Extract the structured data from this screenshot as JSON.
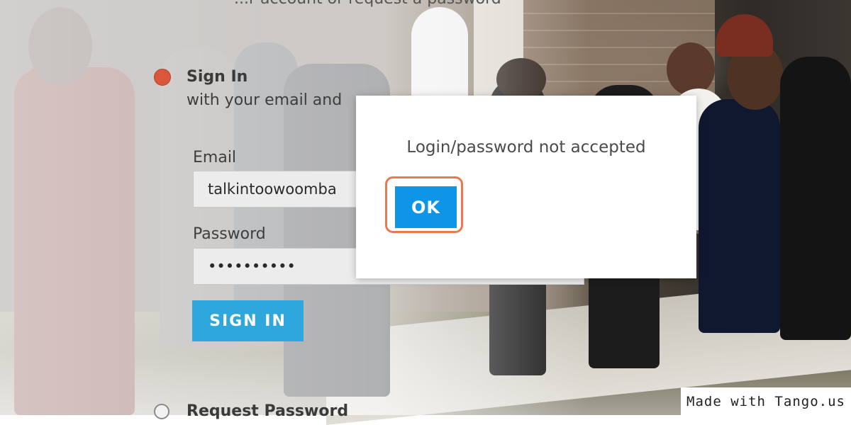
{
  "page": {
    "top_partial_text": "...r account or request a password"
  },
  "signin": {
    "title": "Sign In",
    "subtitle": "with your email and",
    "email_label": "Email",
    "email_value": "talkintoowoomba",
    "password_label": "Password",
    "password_value": "••••••••••",
    "button_label": "SIGN IN",
    "request_label": "Request Password"
  },
  "dialog": {
    "message": "Login/password not accepted",
    "ok_label": "OK"
  },
  "watermark": {
    "text": "Made with Tango.us"
  },
  "colors": {
    "accent_blue": "#0e95e8",
    "signin_blue": "#2ea7dd",
    "active_step_dot": "#d9583b",
    "highlight_orange": "#ea7a4e"
  }
}
